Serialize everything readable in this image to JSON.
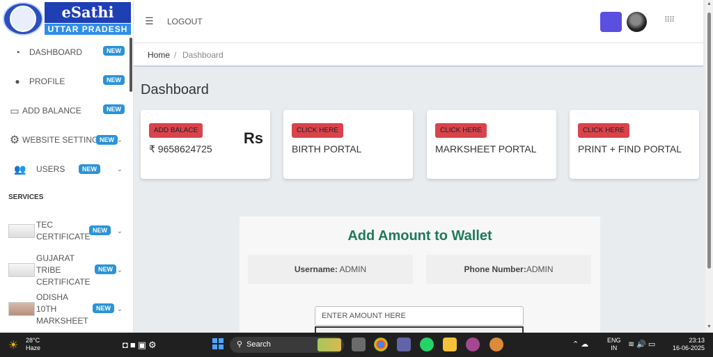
{
  "brand": {
    "name": "eSathi",
    "state": "UTTAR PRADESH"
  },
  "sidebar": {
    "items": [
      {
        "label": "DASHBOARD",
        "badge": "NEW",
        "icon": "dashboard-gauge-icon"
      },
      {
        "label": "PROFILE",
        "badge": "NEW",
        "icon": "profile-avatar-icon"
      },
      {
        "label": "ADD BALANCE",
        "badge": "NEW",
        "icon": "wallet-icon"
      },
      {
        "label": "WEBSITE SETTINGS",
        "badge": "NEW",
        "icon": "gear-icon"
      },
      {
        "label": "USERS",
        "badge": "NEW",
        "icon": "users-icon"
      }
    ],
    "section_title": "SERVICES",
    "services": [
      {
        "label": "TEC CERTIFICATE",
        "badge": "NEW"
      },
      {
        "label": "GUJARAT TRIBE CERTIFICATE",
        "badge": "NEW"
      },
      {
        "label": "ODISHA 10TH MARKSHEET",
        "badge": "NEW"
      }
    ]
  },
  "header": {
    "menu_icon": "☰",
    "logout": "LOGOUT",
    "apps_icon": "⠿⠿"
  },
  "breadcrumb": {
    "home": "Home",
    "sep": "/",
    "current": "Dashboard"
  },
  "page": {
    "title": "Dashboard"
  },
  "cards": [
    {
      "button": "ADD BALACE",
      "value": "₹ 9658624725",
      "symbol": "Rs"
    },
    {
      "button": "CLICK HERE",
      "value": "BIRTH PORTAL"
    },
    {
      "button": "CLICK HERE",
      "value": "MARKSHEET PORTAL"
    },
    {
      "button": "CLICK HERE",
      "value": "PRINT + FIND PORTAL"
    }
  ],
  "wallet": {
    "title": "Add Amount to Wallet",
    "username_label": "Username:",
    "username_value": " ADMIN",
    "phone_label": "Phone Number:",
    "phone_value": "ADMIN",
    "amount_placeholder": "ENTER AMOUNT HERE"
  },
  "taskbar": {
    "temp": "28°C",
    "weather": "Haze",
    "search": "Search",
    "lang_top": "ENG",
    "lang_bottom": "IN",
    "time": "23:13",
    "date": "16-06-2025"
  },
  "colors": {
    "brand_blue": "#1f3fb4",
    "badge_blue": "#2b93d8",
    "card_button_red": "#d9434b",
    "wallet_title_green": "#1d7a5a",
    "profile_square": "#5a4fe0"
  }
}
